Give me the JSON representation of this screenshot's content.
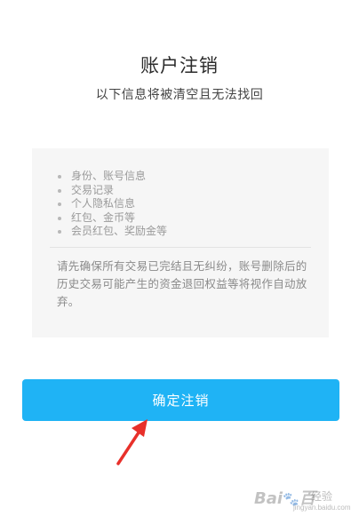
{
  "page": {
    "title": "账户注销",
    "subtitle": "以下信息将被清空且无法找回"
  },
  "info_panel": {
    "items": [
      "身份、账号信息",
      "交易记录",
      "个人隐私信息",
      "红包、金币等",
      "会员红包、奖励金等"
    ],
    "notice": "请先确保所有交易已完结且无纠纷，账号删除后的历史交易可能产生的资金退回权益等将视作自动放弃。"
  },
  "confirm_button": {
    "label": "确定注销",
    "color": "#1fb3f5"
  },
  "annotation": {
    "icon": "red-arrow-icon",
    "color": "#e8302a"
  },
  "watermark": {
    "logo_text": "Bai",
    "logo_suffix": "百",
    "text": "经验",
    "url": "jingyan.baidu.com"
  }
}
